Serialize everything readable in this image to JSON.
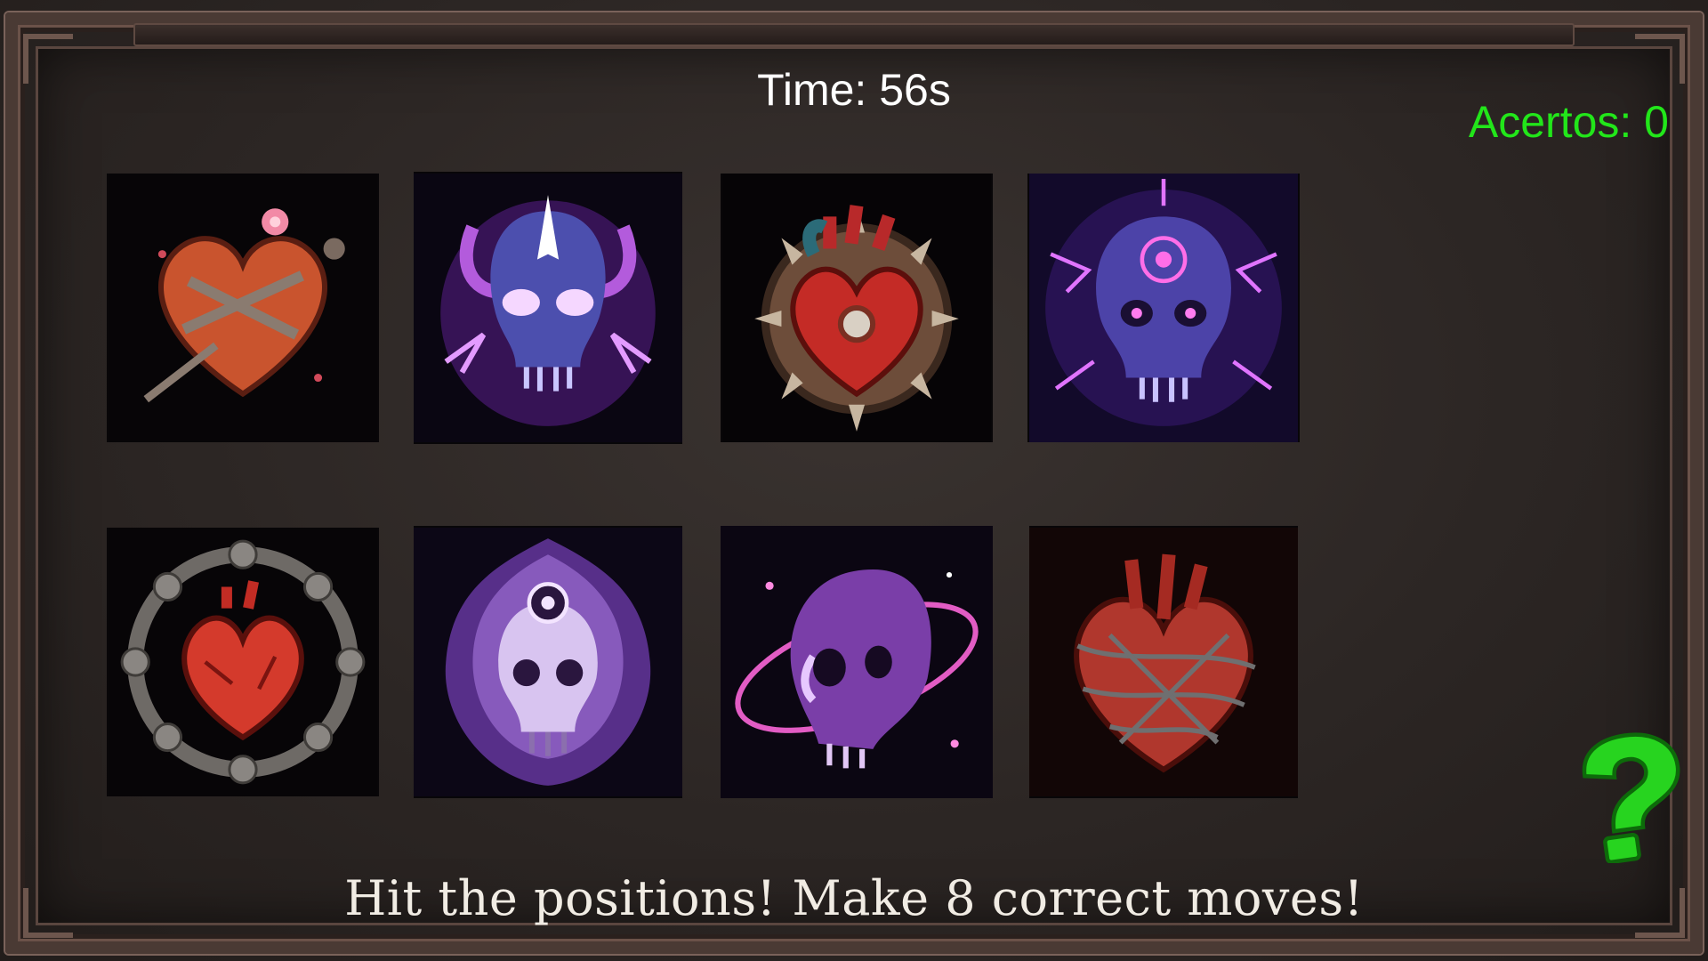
{
  "hud": {
    "timer_text": "Time: 56s",
    "score_text": "Acertos: 0",
    "score_color": "#22e61a"
  },
  "board": {
    "rows": 2,
    "cols": 4,
    "cards": [
      {
        "icon": "thorned-heart-icon"
      },
      {
        "icon": "horned-lightning-skull-icon"
      },
      {
        "icon": "spiked-mechanical-heart-icon"
      },
      {
        "icon": "electric-purple-skull-icon"
      },
      {
        "icon": "runic-ring-heart-icon"
      },
      {
        "icon": "flaming-purple-skull-icon"
      },
      {
        "icon": "orbiting-skull-icon"
      },
      {
        "icon": "barbed-wire-heart-icon"
      }
    ]
  },
  "instructions": "Hit the positions! Make 8 correct moves!",
  "help_button": {
    "icon": "question-mark-icon",
    "color": "#27d41f"
  }
}
